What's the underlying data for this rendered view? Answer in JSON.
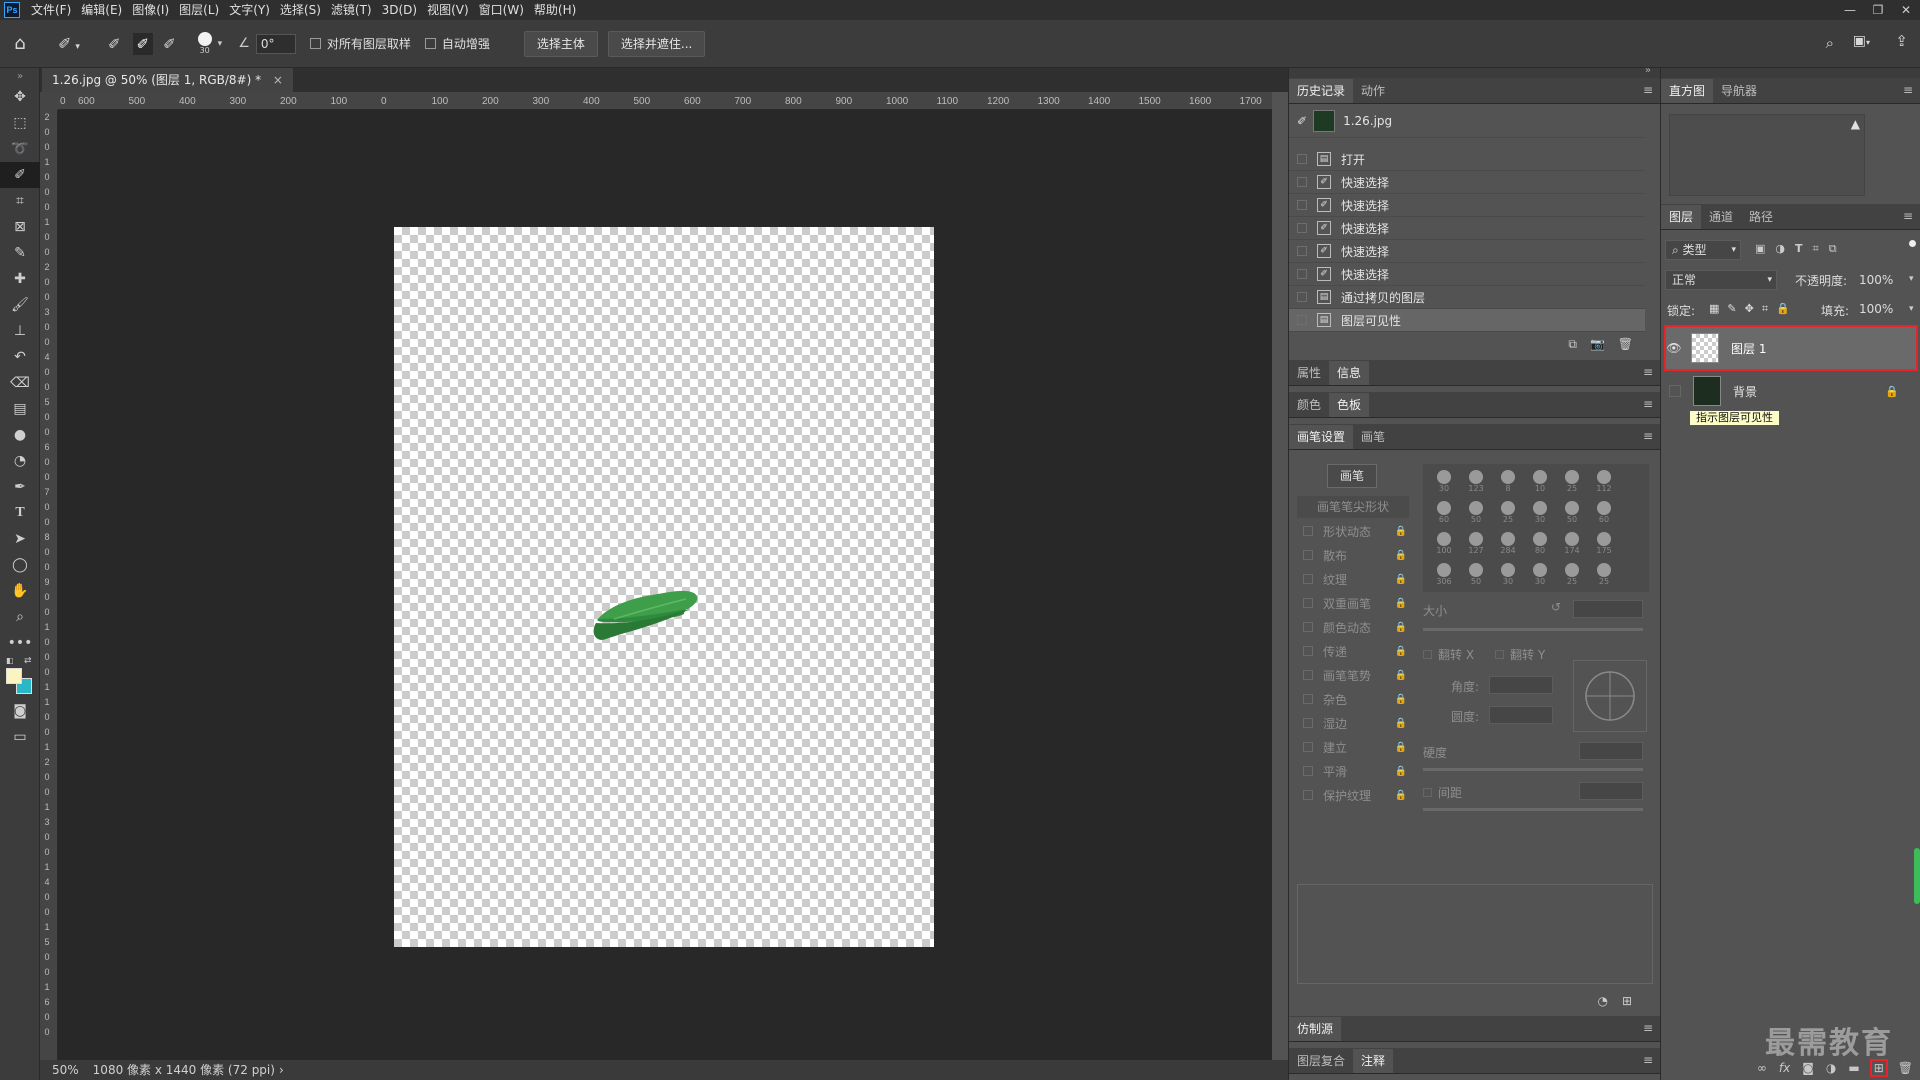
{
  "menubar": {
    "app_logo": "Ps",
    "items": [
      "文件(F)",
      "编辑(E)",
      "图像(I)",
      "图层(L)",
      "文字(Y)",
      "选择(S)",
      "滤镜(T)",
      "3D(D)",
      "视图(V)",
      "窗口(W)",
      "帮助(H)"
    ]
  },
  "options": {
    "brush_size": "30",
    "angle": "0°",
    "sample_all_layers": "对所有图层取样",
    "auto_enhance": "自动增强",
    "select_subject": "选择主体",
    "select_and_mask": "选择并遮住..."
  },
  "document": {
    "tab_title": "1.26.jpg @ 50% (图层 1, RGB/8#) *",
    "close_symbol": "×",
    "zoom": "50%",
    "status_info": "1080 像素 x 1440 像素 (72 ppi)",
    "ruler_h": [
      "0",
      "600",
      "500",
      "400",
      "300",
      "200",
      "100",
      "0",
      "100",
      "200",
      "300",
      "400",
      "500",
      "600",
      "700",
      "800",
      "900",
      "1000",
      "1100",
      "1200",
      "1300",
      "1400",
      "1500",
      "1600",
      "1700"
    ],
    "ruler_v": [
      "2",
      "0",
      "0",
      "1",
      "0",
      "0",
      "0",
      "1",
      "0",
      "0",
      "2",
      "0",
      "0",
      "3",
      "0",
      "0",
      "4",
      "0",
      "0",
      "5",
      "0",
      "0",
      "6",
      "0",
      "0",
      "7",
      "0",
      "0",
      "8",
      "0",
      "0",
      "9",
      "0",
      "0",
      "1",
      "0",
      "0",
      "0",
      "1",
      "1",
      "0",
      "0",
      "1",
      "2",
      "0",
      "0",
      "1",
      "3",
      "0",
      "0",
      "1",
      "4",
      "0",
      "0",
      "1",
      "5",
      "0",
      "0",
      "1",
      "6",
      "0",
      "0"
    ]
  },
  "history_panel": {
    "tabs": [
      "历史记录",
      "动作"
    ],
    "snapshot": "1.26.jpg",
    "steps": [
      "打开",
      "快速选择",
      "快速选择",
      "快速选择",
      "快速选择",
      "快速选择",
      "通过拷贝的图层",
      "图层可见性"
    ]
  },
  "props_panel": {
    "tabs": [
      "属性",
      "信息"
    ]
  },
  "color_panel": {
    "tabs": [
      "颜色",
      "色板"
    ]
  },
  "brush_panel": {
    "tabs": [
      "画笔设置",
      "画笔"
    ],
    "brush_button": "画笔",
    "tip_shape": "画笔笔尖形状",
    "options": [
      "形状动态",
      "散布",
      "纹理",
      "双重画笔",
      "颜色动态",
      "传递",
      "画笔笔势",
      "杂色",
      "湿边",
      "建立",
      "平滑",
      "保护纹理"
    ],
    "tip_sizes": [
      "30",
      "123",
      "8",
      "10",
      "25",
      "112",
      "60",
      "50",
      "25",
      "30",
      "50",
      "60",
      "100",
      "127",
      "284",
      "80",
      "174",
      "175",
      "306",
      "50",
      "30",
      "30",
      "25",
      "25"
    ],
    "size_label": "大小",
    "flip_x": "翻转 X",
    "flip_y": "翻转 Y",
    "angle_label": "角度:",
    "roundness_label": "圆度:",
    "hardness_label": "硬度",
    "spacing_label": "间距"
  },
  "bottom_panels": {
    "clone": "仿制源",
    "tabs": [
      "图层复合",
      "注释"
    ]
  },
  "histogram_panel": {
    "tabs": [
      "直方图",
      "导航器"
    ]
  },
  "layers_panel": {
    "tabs": [
      "图层",
      "通道",
      "路径"
    ],
    "filter_kind": "类型",
    "blend_mode": "正常",
    "opacity_label": "不透明度:",
    "opacity_value": "100%",
    "lock_label": "锁定:",
    "fill_label": "填充:",
    "fill_value": "100%",
    "layers": [
      {
        "name": "图层 1",
        "selected": true
      },
      {
        "name": "背景",
        "locked": true
      }
    ],
    "tooltip": "指示图层可见性"
  },
  "watermark": "最需教育",
  "colors": {
    "highlight_red": "#e8232a",
    "leaf_green": "#3f9e4a",
    "tooltip_bg": "#fdfdc8"
  }
}
